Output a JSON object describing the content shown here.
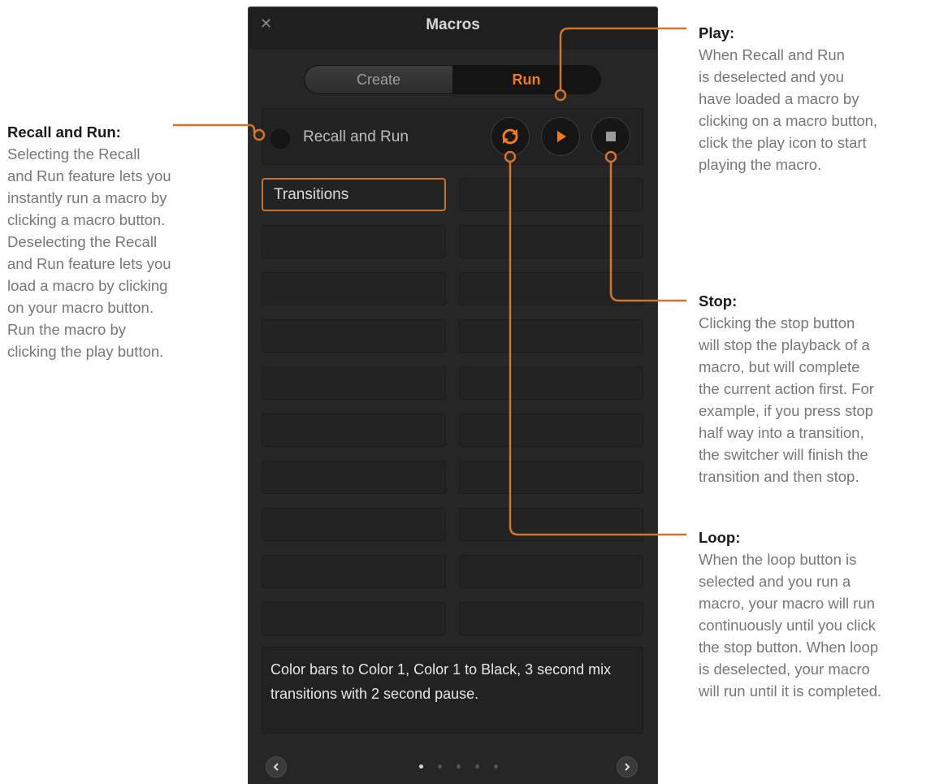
{
  "panel": {
    "title": "Macros",
    "close_glyph": "✕",
    "tabs": [
      {
        "label": "Create",
        "active": false
      },
      {
        "label": "Run",
        "active": true
      }
    ],
    "recall_run_label": "Recall and Run",
    "controls": {
      "loop_icon": "loop-icon",
      "play_icon": "play-icon",
      "stop_icon": "stop-icon"
    },
    "macros": [
      "Transitions",
      "",
      "",
      "",
      "",
      "",
      "",
      "",
      "",
      "",
      "",
      "",
      "",
      "",
      "",
      "",
      "",
      "",
      "",
      ""
    ],
    "description": "Color bars to Color 1, Color 1 to Black, 3 second mix transitions with 2 second pause.",
    "pager": {
      "pages": 5,
      "current": 1
    }
  },
  "annotations": {
    "recall_run": {
      "head": "Recall and Run:",
      "body": "Selecting the Recall\nand Run feature lets you\ninstantly run a macro by\nclicking a macro button.\nDeselecting the Recall\nand Run feature lets you\nload a macro by clicking\non your macro button.\nRun the macro by\nclicking the play button."
    },
    "play": {
      "head": "Play:",
      "body": "When Recall and Run\nis deselected and you\nhave loaded a macro by\nclicking on a macro button,\nclick the play icon to start\nplaying the macro."
    },
    "stop": {
      "head": "Stop:",
      "body": "Clicking the stop button\nwill stop the playback of a\nmacro, but will complete\nthe current action first. For\nexample, if you press stop\nhalf way into a transition,\nthe switcher will finish the\ntransition and then stop."
    },
    "loop": {
      "head": "Loop:",
      "body": "When the loop button is\nselected and you run a\nmacro, your macro will run\ncontinuously until you click\nthe stop button. When loop\nis deselected, your macro\nwill run until it is completed."
    }
  },
  "colors": {
    "accent": "#f07a22",
    "callout": "#d4742c"
  }
}
